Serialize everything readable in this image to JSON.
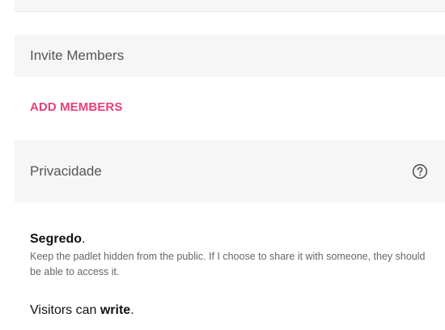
{
  "invite": {
    "header_label": "Invite Members",
    "add_members_label": "ADD MEMBERS"
  },
  "privacy": {
    "header_label": "Privacidade",
    "help_icon": "help-circle-icon",
    "selected_option": {
      "title": "Segredo",
      "title_suffix": ".",
      "description": "Keep the padlet hidden from the public. If I choose to share it with someone, they should be able to access it."
    },
    "visitors": {
      "prefix": "Visitors can ",
      "permission": "write",
      "suffix": "."
    }
  },
  "colors": {
    "accent": "#e8407a",
    "section_background": "#f6f6f6"
  }
}
